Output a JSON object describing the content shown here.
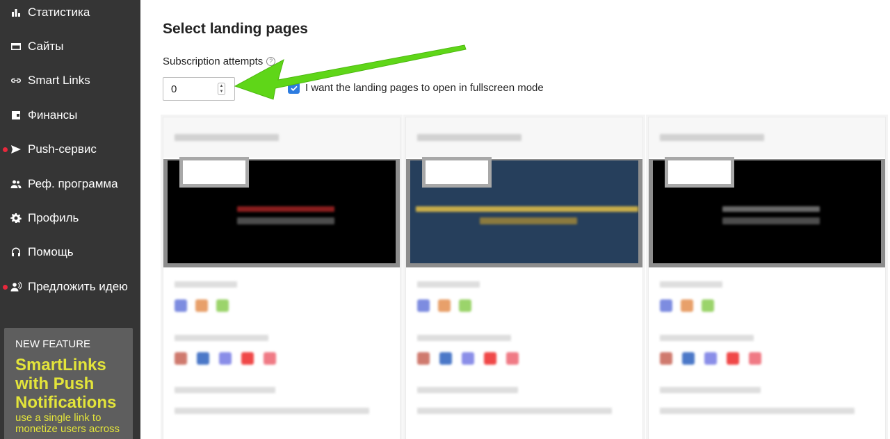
{
  "sidebar": {
    "items": [
      {
        "label": "Статистика",
        "icon": "bar-chart-icon",
        "dot": false
      },
      {
        "label": "Сайты",
        "icon": "browser-window-icon",
        "dot": false
      },
      {
        "label": "Smart Links",
        "icon": "link-icon",
        "dot": false
      },
      {
        "label": "Финансы",
        "icon": "wallet-icon",
        "dot": false
      },
      {
        "label": "Push-сервис",
        "icon": "send-icon",
        "dot": true
      },
      {
        "label": "Реф. программа",
        "icon": "people-icon",
        "dot": false
      },
      {
        "label": "Профиль",
        "icon": "gear-icon",
        "dot": false
      },
      {
        "label": "Помощь",
        "icon": "headset-icon",
        "dot": false
      },
      {
        "label": "Предложить идею",
        "icon": "speaker-person-icon",
        "dot": true
      }
    ],
    "promo": {
      "tag": "NEW FEATURE",
      "title": "SmartLinks with Push Notifications",
      "text": "use a single link to monetize users across"
    }
  },
  "main": {
    "title": "Select landing pages",
    "attempts_label": "Subscription attempts",
    "help_symbol": "?",
    "attempts_value": "0",
    "fullscreen_label": "I want the landing pages to open in fullscreen mode",
    "fullscreen_checked": true
  },
  "cards": [
    {
      "preview_bg": "#000000",
      "bar_color": "#8a1e1e",
      "accent": "#4d4d4d"
    },
    {
      "preview_bg": "#263f5c",
      "bar_color": "#c9ae4a",
      "accent": "#8b7a3f"
    },
    {
      "preview_bg": "#000000",
      "bar_color": "#6a6a6a",
      "accent": "#4d4d4d"
    }
  ],
  "colors": {
    "sidebar_bg": "#353535",
    "promo_bg": "#5e5e5e",
    "promo_text": "#e3e43a",
    "checkbox": "#2d7ce0",
    "arrow": "#5fd618",
    "notification_dot": "#e8283c"
  }
}
